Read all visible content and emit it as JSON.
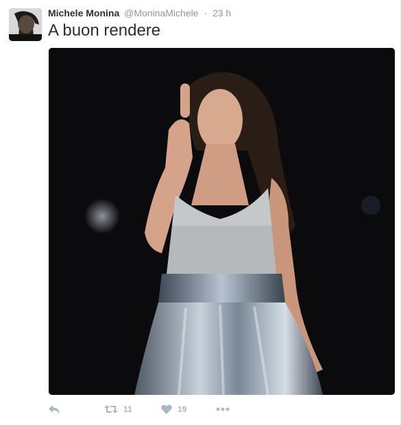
{
  "tweet": {
    "author": {
      "name": "Michele Monina",
      "handle": "@MoninaMichele",
      "separator": "·",
      "time": "23 h"
    },
    "text": "A buon rendere",
    "media": {
      "type": "photo",
      "description_icon": "photo"
    },
    "actions": {
      "reply_icon": "reply-icon",
      "retweet_icon": "retweet-icon",
      "retweet_count": "11",
      "like_icon": "heart-icon",
      "like_count": "19",
      "more_icon": "more-icon"
    }
  },
  "colors": {
    "text": "#292f33",
    "secondary": "#8899a6",
    "action": "#aab8c2",
    "media_bg": "#0b0b0d"
  }
}
